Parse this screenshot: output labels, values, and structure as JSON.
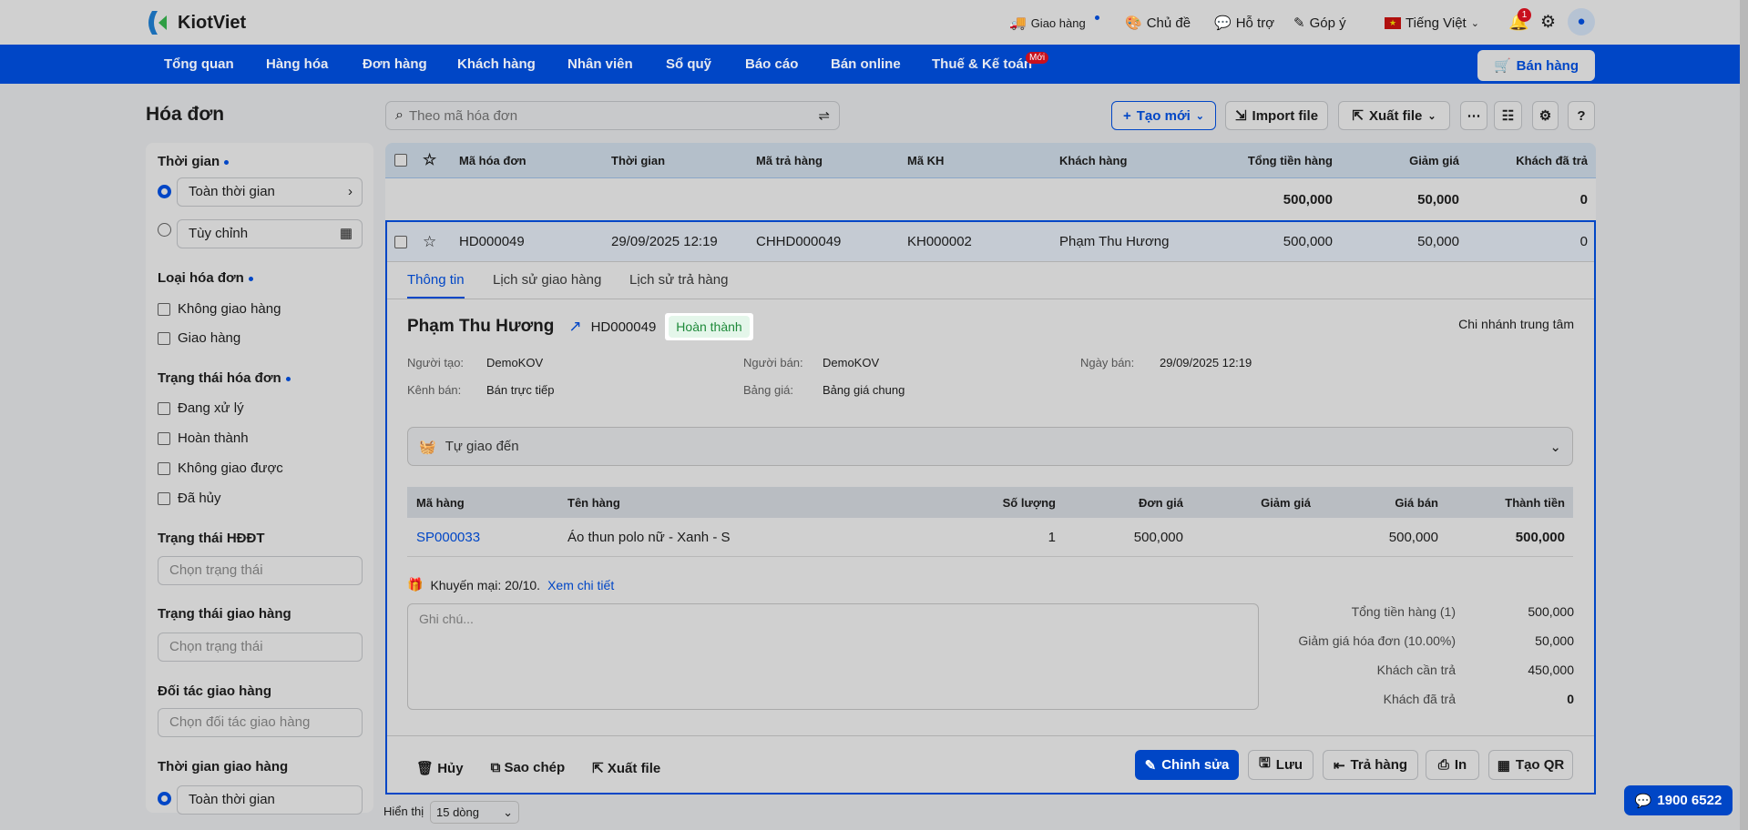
{
  "brand": {
    "name": "KiotViet"
  },
  "topbar": {
    "delivery": "Giao hàng",
    "theme": "Chủ đề",
    "support": "Hỗ trợ",
    "feedback": "Góp ý",
    "language": "Tiếng Việt",
    "notifications": "1"
  },
  "nav": {
    "items": [
      "Tổng quan",
      "Hàng hóa",
      "Đơn hàng",
      "Khách hàng",
      "Nhân viên",
      "Sổ quỹ",
      "Báo cáo",
      "Bán online",
      "Thuế & Kế toán"
    ],
    "new_badge": "Mới",
    "sell_button": "Bán hàng"
  },
  "page": {
    "title": "Hóa đơn",
    "search_placeholder": "Theo mã hóa đơn"
  },
  "toolbar": {
    "create": "Tạo mới",
    "import": "Import file",
    "export": "Xuất file"
  },
  "sidebar": {
    "time": {
      "title": "Thời gian",
      "all": "Toàn thời gian",
      "custom": "Tùy chỉnh"
    },
    "invoice_type": {
      "title": "Loại hóa đơn",
      "options": [
        "Không giao hàng",
        "Giao hàng"
      ]
    },
    "invoice_status": {
      "title": "Trạng thái hóa đơn",
      "options": [
        "Đang xử lý",
        "Hoàn thành",
        "Không giao được",
        "Đã hủy"
      ]
    },
    "einvoice_status": {
      "title": "Trạng thái HĐĐT",
      "placeholder": "Chọn trạng thái"
    },
    "delivery_status": {
      "title": "Trạng thái giao hàng",
      "placeholder": "Chọn trạng thái"
    },
    "delivery_partner": {
      "title": "Đối tác giao hàng",
      "placeholder": "Chọn đối tác giao hàng"
    },
    "delivery_time": {
      "title": "Thời gian giao hàng",
      "all": "Toàn thời gian"
    }
  },
  "table": {
    "headers": [
      "Mã hóa đơn",
      "Thời gian",
      "Mã trả hàng",
      "Mã KH",
      "Khách hàng",
      "Tổng tiền hàng",
      "Giảm giá",
      "Khách đã trả"
    ],
    "totals": {
      "subtotal": "500,000",
      "discount": "50,000",
      "paid": "0"
    },
    "rows": [
      {
        "code": "HD000049",
        "time": "29/09/2025 12:19",
        "return_code": "CHHD000049",
        "customer_code": "KH000002",
        "customer": "Phạm Thu Hương",
        "subtotal": "500,000",
        "discount": "50,000",
        "paid": "0"
      }
    ]
  },
  "detail": {
    "tabs": [
      "Thông tin",
      "Lịch sử giao hàng",
      "Lịch sử trả hàng"
    ],
    "customer": "Phạm Thu Hương",
    "code": "HD000049",
    "status": "Hoàn thành",
    "branch": "Chi nhánh trung tâm",
    "info": [
      {
        "label": "Người tạo:",
        "value": "DemoKOV"
      },
      {
        "label": "Người bán:",
        "value": "DemoKOV"
      },
      {
        "label": "Ngày bán:",
        "value": "29/09/2025 12:19"
      },
      {
        "label": "Kênh bán:",
        "value": "Bán trực tiếp"
      },
      {
        "label": "Bảng giá:",
        "value": "Bảng giá chung"
      }
    ],
    "delivery": "Tự giao đến",
    "items_headers": [
      "Mã hàng",
      "Tên hàng",
      "Số lượng",
      "Đơn giá",
      "Giảm giá",
      "Giá bán",
      "Thành tiền"
    ],
    "items": [
      {
        "code": "SP000033",
        "name": "Áo thun polo nữ - Xanh - S",
        "qty": "1",
        "price": "500,000",
        "discount": "",
        "sell": "500,000",
        "total": "500,000"
      }
    ],
    "promo": "Khuyến mại: 20/10.",
    "promo_link": "Xem chi tiết",
    "note_placeholder": "Ghi chú...",
    "summary": [
      {
        "label": "Tổng tiền hàng (1)",
        "value": "500,000"
      },
      {
        "label": "Giảm giá hóa đơn (10.00%)",
        "value": "50,000"
      },
      {
        "label": "Khách cần trả",
        "value": "450,000"
      },
      {
        "label": "Khách đã trả",
        "value": "0"
      }
    ],
    "actions": {
      "cancel": "Hủy",
      "copy": "Sao chép",
      "export": "Xuất file",
      "edit": "Chỉnh sửa",
      "save": "Lưu",
      "return": "Trả hàng",
      "print": "In",
      "qr": "Tạo QR"
    }
  },
  "footer": {
    "show_label": "Hiển thị",
    "page_size": "15 dòng",
    "hotline": "1900 6522"
  },
  "colors": {
    "brand": "#0046c6",
    "success": "#1e8a3a"
  }
}
